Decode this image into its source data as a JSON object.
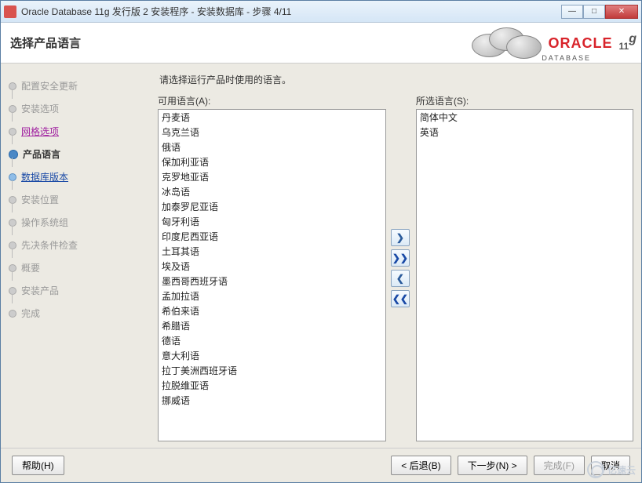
{
  "window": {
    "title": "Oracle Database 11g 发行版 2 安装程序 - 安装数据库 - 步骤 4/11"
  },
  "header": {
    "title": "选择产品语言",
    "brand_word": "ORACLE",
    "brand_sub": "DATABASE",
    "brand_ver": "11",
    "brand_ver_sup": "g"
  },
  "sidebar": {
    "items": [
      {
        "label": "配置安全更新",
        "state": "disabled"
      },
      {
        "label": "安装选项",
        "state": "disabled"
      },
      {
        "label": "网格选项",
        "state": "linkm"
      },
      {
        "label": "产品语言",
        "state": "current"
      },
      {
        "label": "数据库版本",
        "state": "link"
      },
      {
        "label": "安装位置",
        "state": "disabled"
      },
      {
        "label": "操作系统组",
        "state": "disabled"
      },
      {
        "label": "先决条件检查",
        "state": "disabled"
      },
      {
        "label": "概要",
        "state": "disabled"
      },
      {
        "label": "安装产品",
        "state": "disabled"
      },
      {
        "label": "完成",
        "state": "disabled"
      }
    ]
  },
  "main": {
    "instruction": "请选择运行产品时使用的语言。",
    "available_label": "可用语言(A):",
    "selected_label": "所选语言(S):",
    "available": [
      "丹麦语",
      "乌克兰语",
      "俄语",
      "保加利亚语",
      "克罗地亚语",
      "冰岛语",
      "加泰罗尼亚语",
      "匈牙利语",
      "印度尼西亚语",
      "土耳其语",
      "埃及语",
      "墨西哥西班牙语",
      "孟加拉语",
      "希伯来语",
      "希腊语",
      "德语",
      "意大利语",
      "拉丁美洲西班牙语",
      "拉脱维亚语",
      "挪威语"
    ],
    "selected": [
      "简体中文",
      "英语"
    ]
  },
  "arrows": {
    "add": "❯",
    "add_all": "❯❯",
    "remove": "❮",
    "remove_all": "❮❮"
  },
  "footer": {
    "help": "帮助(H)",
    "back": "< 后退(B)",
    "next": "下一步(N) >",
    "finish": "完成(F)",
    "cancel": "取消"
  },
  "watermark": "亿速云"
}
